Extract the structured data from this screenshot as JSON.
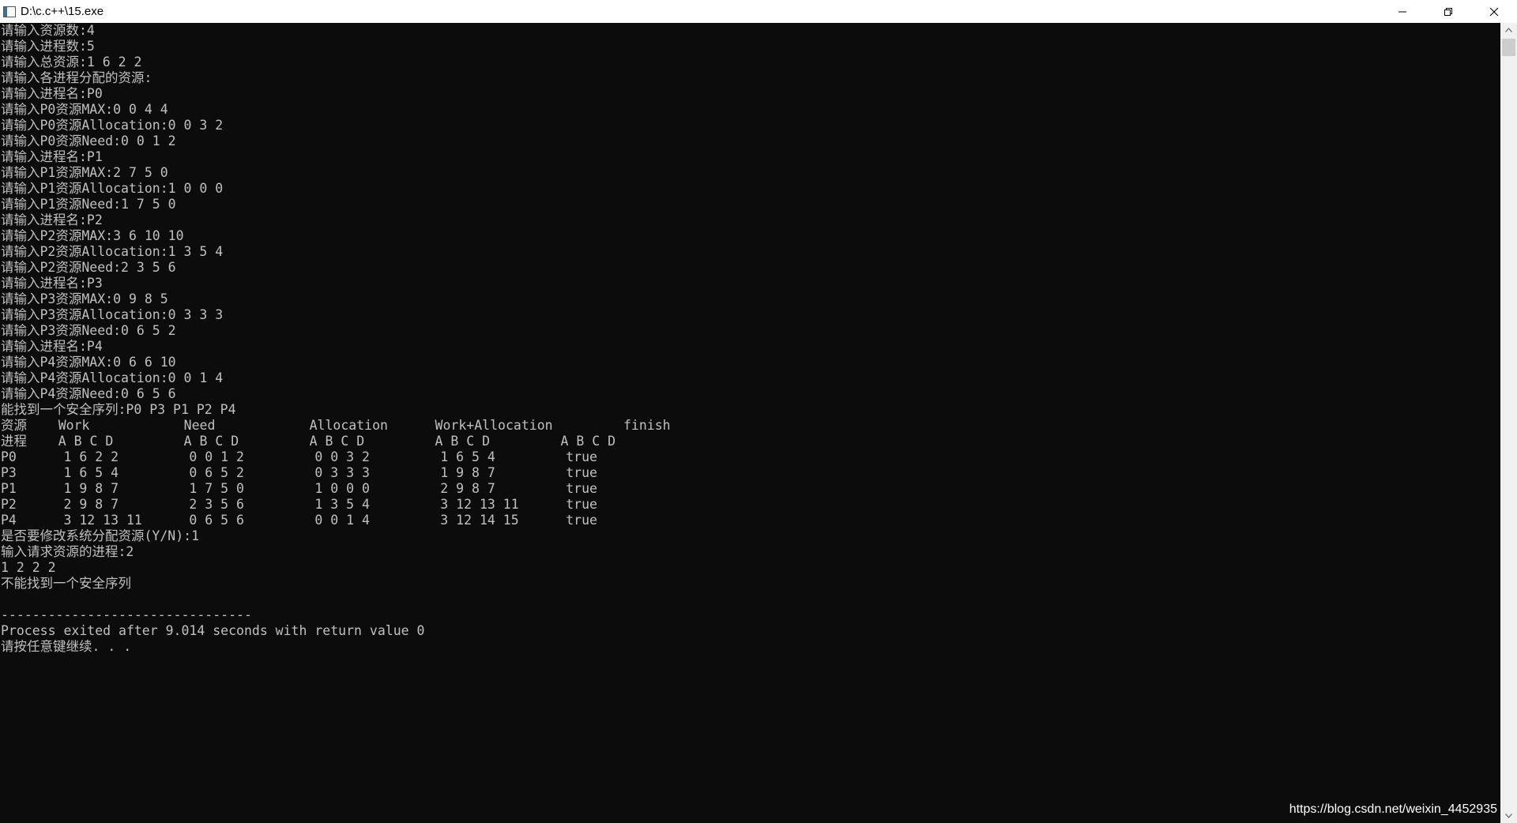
{
  "window": {
    "title": "D:\\c.c++\\15.exe",
    "icon": "console-app-icon",
    "controls": [
      "minimize-icon",
      "restore-icon",
      "close-icon"
    ]
  },
  "console": {
    "lines": [
      "请输入资源数:4",
      "请输入进程数:5",
      "请输入总资源:1 6 2 2",
      "请输入各进程分配的资源:",
      "请输入进程名:P0",
      "请输入P0资源MAX:0 0 4 4",
      "请输入P0资源Allocation:0 0 3 2",
      "请输入P0资源Need:0 0 1 2",
      "请输入进程名:P1",
      "请输入P1资源MAX:2 7 5 0",
      "请输入P1资源Allocation:1 0 0 0",
      "请输入P1资源Need:1 7 5 0",
      "请输入进程名:P2",
      "请输入P2资源MAX:3 6 10 10",
      "请输入P2资源Allocation:1 3 5 4",
      "请输入P2资源Need:2 3 5 6",
      "请输入进程名:P3",
      "请输入P3资源MAX:0 9 8 5",
      "请输入P3资源Allocation:0 3 3 3",
      "请输入P3资源Need:0 6 5 2",
      "请输入进程名:P4",
      "请输入P4资源MAX:0 6 6 10",
      "请输入P4资源Allocation:0 0 1 4",
      "请输入P4资源Need:0 6 5 6",
      "能找到一个安全序列:P0 P3 P1 P2 P4",
      "资源    Work            Need            Allocation      Work+Allocation         finish",
      "进程    A B C D         A B C D         A B C D         A B C D         A B C D",
      "P0      1 6 2 2         0 0 1 2         0 0 3 2         1 6 5 4         true",
      "P3      1 6 5 4         0 6 5 2         0 3 3 3         1 9 8 7         true",
      "P1      1 9 8 7         1 7 5 0         1 0 0 0         2 9 8 7         true",
      "P2      2 9 8 7         2 3 5 6         1 3 5 4         3 12 13 11      true",
      "P4      3 12 13 11      0 6 5 6         0 0 1 4         3 12 14 15      true",
      "是否要修改系统分配资源(Y/N):1",
      "输入请求资源的进程:2",
      "1 2 2 2",
      "不能找到一个安全序列",
      "",
      "--------------------------------",
      "Process exited after 9.014 seconds with return value 0",
      "请按任意键继续. . ."
    ]
  },
  "watermark": "https://blog.csdn.net/weixin_4452935",
  "colors": {
    "console_bg": "#0c0c0c",
    "console_fg": "#c0c0c0",
    "titlebar_bg": "#ffffff",
    "scrollbar_bg": "#f0f0f0"
  }
}
